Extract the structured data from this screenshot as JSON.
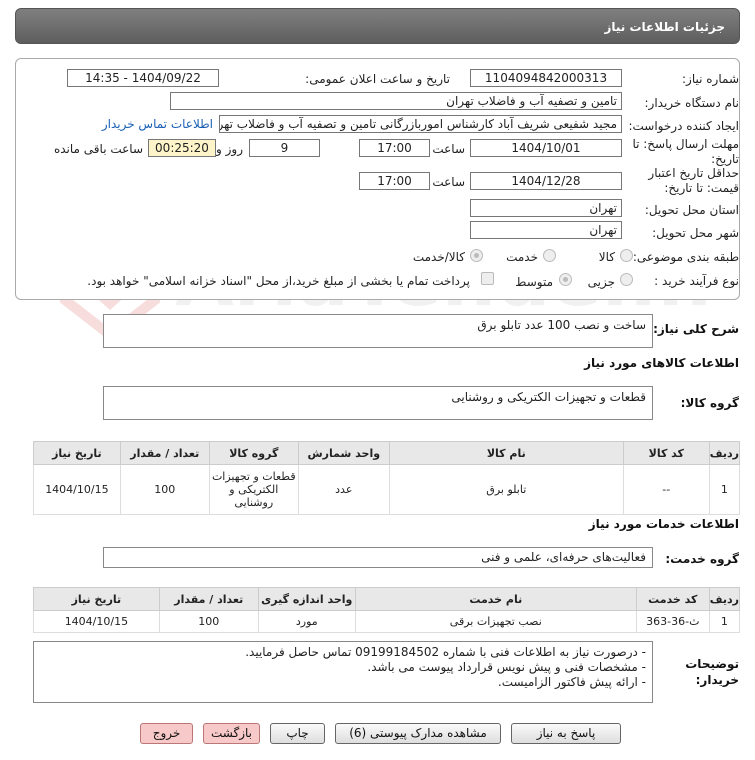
{
  "header": {
    "title": "جزئیات اطلاعات نیاز"
  },
  "info": {
    "need_number_label": "شماره نیاز:",
    "need_number": "1104094842000313",
    "announce_label": "تاریخ و ساعت اعلان عمومی:",
    "announce_value": "1404/09/22 - 14:35",
    "buyer_label": "نام دستگاه خریدار:",
    "buyer_value": "تامین و تصفیه آب و فاضلاب تهران",
    "creator_label": "ایجاد کننده درخواست:",
    "creator_value": "مجید شفیعی شریف آباد کارشناس اموربازرگانی تامین و تصفیه آب و فاضلاب تهران",
    "contact_link": "اطلاعات تماس خریدار",
    "deadline_label": "مهلت ارسال پاسخ: تا تاریخ:",
    "deadline_date": "1404/10/01",
    "time_label": "ساعت",
    "deadline_time": "17:00",
    "days_value": "9",
    "days_label": "روز و",
    "remaining_time": "00:25:20",
    "remaining_label": "ساعت باقی مانده",
    "price_valid_label": "حداقل تاریخ اعتبار قیمت: تا تاریخ:",
    "price_valid_date": "1404/12/28",
    "price_valid_time": "17:00",
    "province_label": "استان محل تحویل:",
    "province_value": "تهران",
    "city_label": "شهر محل تحویل:",
    "city_value": "تهران",
    "category_label": "طبقه بندی موضوعی:",
    "category_options": [
      "کالا",
      "خدمت",
      "کالا/خدمت"
    ],
    "category_selected": "کالا/خدمت",
    "process_label": "نوع فرآیند خرید :",
    "process_options": [
      "جزیی",
      "متوسط"
    ],
    "process_selected": "متوسط",
    "treasury_note": "پرداخت تمام یا بخشی از مبلغ خرید،از محل \"اسناد خزانه اسلامی\" خواهد بود."
  },
  "description": {
    "label": "شرح کلی نیاز:",
    "value": "ساخت و نصب 100 عدد تابلو برق"
  },
  "goods": {
    "section_title": "اطلاعات کالاهای مورد نیاز",
    "group_label": "گروه کالا:",
    "group_value": "قطعات و تجهیزات الکتریکی و روشنایی",
    "columns": [
      "ردیف",
      "کد کالا",
      "نام کالا",
      "واحد شمارش",
      "گروه کالا",
      "تعداد / مقدار",
      "تاریخ نیاز"
    ],
    "rows": [
      {
        "row": "1",
        "code": "--",
        "name": "تابلو برق",
        "unit": "عدد",
        "group": "قطعات و تجهیزات الکتریکی و روشنایی",
        "qty": "100",
        "date": "1404/10/15"
      }
    ]
  },
  "services": {
    "section_title": "اطلاعات خدمات مورد نیاز",
    "group_label": "گروه خدمت:",
    "group_value": "فعالیت‌های حرفه‌ای، علمی و فنی",
    "columns": [
      "ردیف",
      "کد خدمت",
      "نام خدمت",
      "واحد اندازه گیری",
      "تعداد / مقدار",
      "تاریخ نیاز"
    ],
    "rows": [
      {
        "row": "1",
        "code": "ث-36-363",
        "name": "نصب تجهیزات برقی",
        "unit": "مورد",
        "qty": "100",
        "date": "1404/10/15"
      }
    ]
  },
  "notes": {
    "label": "توضیحات خریدار:",
    "lines": [
      "- درصورت نیاز به اطلاعات فنی با شماره 09199184502 تماس حاصل فرمایید.",
      "- مشخصات فنی و پیش نویس قرارداد پیوست می باشد.",
      "- ارائه پیش فاکتور الزامیست."
    ]
  },
  "buttons": {
    "reply": "پاسخ به نیاز",
    "attachments": "مشاهده مدارک پیوستی (6)",
    "print": "چاپ",
    "back": "بازگشت",
    "exit": "خروج"
  },
  "watermark": {
    "text": "AriaTender.neT"
  },
  "colors": {
    "header_bg": "#6b6b6b",
    "link": "#1a5fb4",
    "remaining_bg": "#fdf5c9",
    "exit_bg": "#f7c9c9"
  }
}
